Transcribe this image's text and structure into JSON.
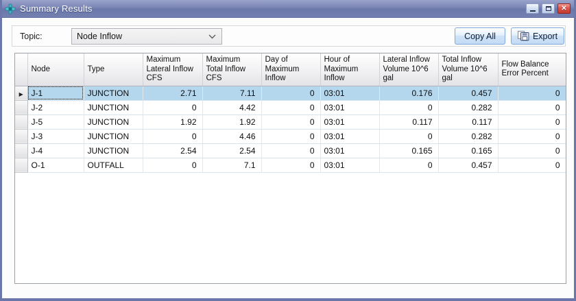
{
  "window": {
    "title": "Summary Results"
  },
  "icons": {
    "app": "node-icon",
    "minimize": "minimize-icon",
    "maximize": "maximize-icon",
    "close": "close-icon",
    "dropdown": "chevron-down-icon",
    "export": "export-save-icon",
    "selected_row": "row-arrow-icon"
  },
  "toolbar": {
    "topic_label": "Topic:",
    "topic_value": "Node Inflow",
    "copy_all_label": "Copy All",
    "export_label": "Export"
  },
  "table": {
    "columns": [
      {
        "key": "node",
        "label": "Node",
        "align": "left"
      },
      {
        "key": "type",
        "label": "Type",
        "align": "left"
      },
      {
        "key": "max_lateral_inflow",
        "label": "Maximum Lateral Inflow CFS",
        "align": "right"
      },
      {
        "key": "max_total_inflow",
        "label": "Maximum Total Inflow CFS",
        "align": "right"
      },
      {
        "key": "day_of_max",
        "label": "Day of Maximum Inflow",
        "align": "right"
      },
      {
        "key": "hour_of_max",
        "label": "Hour of Maximum Inflow",
        "align": "left"
      },
      {
        "key": "lateral_volume",
        "label": "Lateral Inflow Volume 10^6 gal",
        "align": "right"
      },
      {
        "key": "total_volume",
        "label": "Total Inflow Volume 10^6 gal",
        "align": "right"
      },
      {
        "key": "flow_balance",
        "label": "Flow Balance Error Percent",
        "align": "right"
      }
    ],
    "rows": [
      {
        "selected": true,
        "cells": [
          "J-1",
          "JUNCTION",
          "2.71",
          "7.11",
          "0",
          "03:01",
          "0.176",
          "0.457",
          "0"
        ]
      },
      {
        "selected": false,
        "cells": [
          "J-2",
          "JUNCTION",
          "0",
          "4.42",
          "0",
          "03:01",
          "0",
          "0.282",
          "0"
        ]
      },
      {
        "selected": false,
        "cells": [
          "J-5",
          "JUNCTION",
          "1.92",
          "1.92",
          "0",
          "03:01",
          "0.117",
          "0.117",
          "0"
        ]
      },
      {
        "selected": false,
        "cells": [
          "J-3",
          "JUNCTION",
          "0",
          "4.46",
          "0",
          "03:01",
          "0",
          "0.282",
          "0"
        ]
      },
      {
        "selected": false,
        "cells": [
          "J-4",
          "JUNCTION",
          "2.54",
          "2.54",
          "0",
          "03:01",
          "0.165",
          "0.165",
          "0"
        ]
      },
      {
        "selected": false,
        "cells": [
          "O-1",
          "OUTFALL",
          "0",
          "7.1",
          "0",
          "03:01",
          "0",
          "0.457",
          "0"
        ]
      }
    ],
    "selected_cell": {
      "row": 0,
      "col": 0
    }
  },
  "colors": {
    "titlebar": "#7380b0",
    "window_border": "#6b77ab",
    "selection": "#b5d7ee",
    "button_border": "#7fa8d9",
    "close_button": "#d9534f",
    "app_icon_teal": "#3fb6c9"
  }
}
